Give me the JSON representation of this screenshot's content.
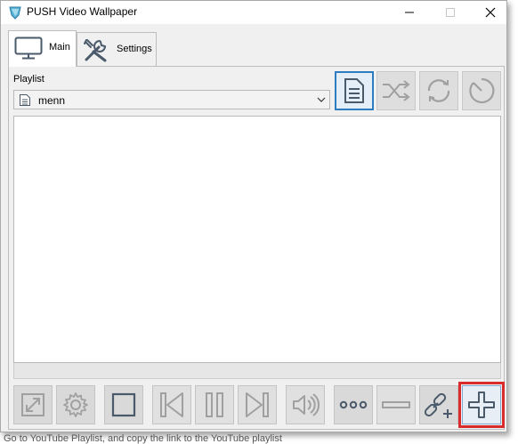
{
  "window": {
    "title": "PUSH Video Wallpaper"
  },
  "tabs": [
    {
      "label": "Main",
      "icon": "monitor-icon",
      "selected": true
    },
    {
      "label": "Settings",
      "icon": "tools-icon",
      "selected": false
    }
  ],
  "playlist": {
    "label": "Playlist",
    "selected_value": "menn",
    "icon": "document-icon"
  },
  "toolbar_top": [
    {
      "name": "playlist-button",
      "icon": "document-icon",
      "active": true
    },
    {
      "name": "shuffle-button",
      "icon": "shuffle-icon",
      "active": false
    },
    {
      "name": "repeat-button",
      "icon": "repeat-icon",
      "active": false
    },
    {
      "name": "timer-button",
      "icon": "timer-icon",
      "active": false
    }
  ],
  "toolbar_bottom": [
    {
      "name": "fullscreen-button",
      "icon": "expand-icon"
    },
    {
      "name": "settings-button",
      "icon": "gear-icon"
    },
    {
      "name": "stop-button",
      "icon": "stop-icon"
    },
    {
      "name": "previous-button",
      "icon": "skip-previous-icon"
    },
    {
      "name": "pause-button",
      "icon": "pause-icon"
    },
    {
      "name": "next-button",
      "icon": "skip-next-icon"
    },
    {
      "name": "volume-button",
      "icon": "volume-icon"
    },
    {
      "name": "more-button",
      "icon": "ellipsis-icon"
    },
    {
      "name": "remove-button",
      "icon": "minus-icon"
    },
    {
      "name": "add-link-button",
      "icon": "link-add-icon"
    },
    {
      "name": "add-file-button",
      "icon": "plus-icon",
      "highlighted": true
    }
  ],
  "colors": {
    "accent": "#2c7cbf",
    "highlight": "#d92b2b",
    "icon_gray": "#9a9a9a",
    "icon_dark": "#4a5a6a"
  },
  "below_window_text": "Go to YouTube Playlist, and copy the link to the YouTube playlist"
}
